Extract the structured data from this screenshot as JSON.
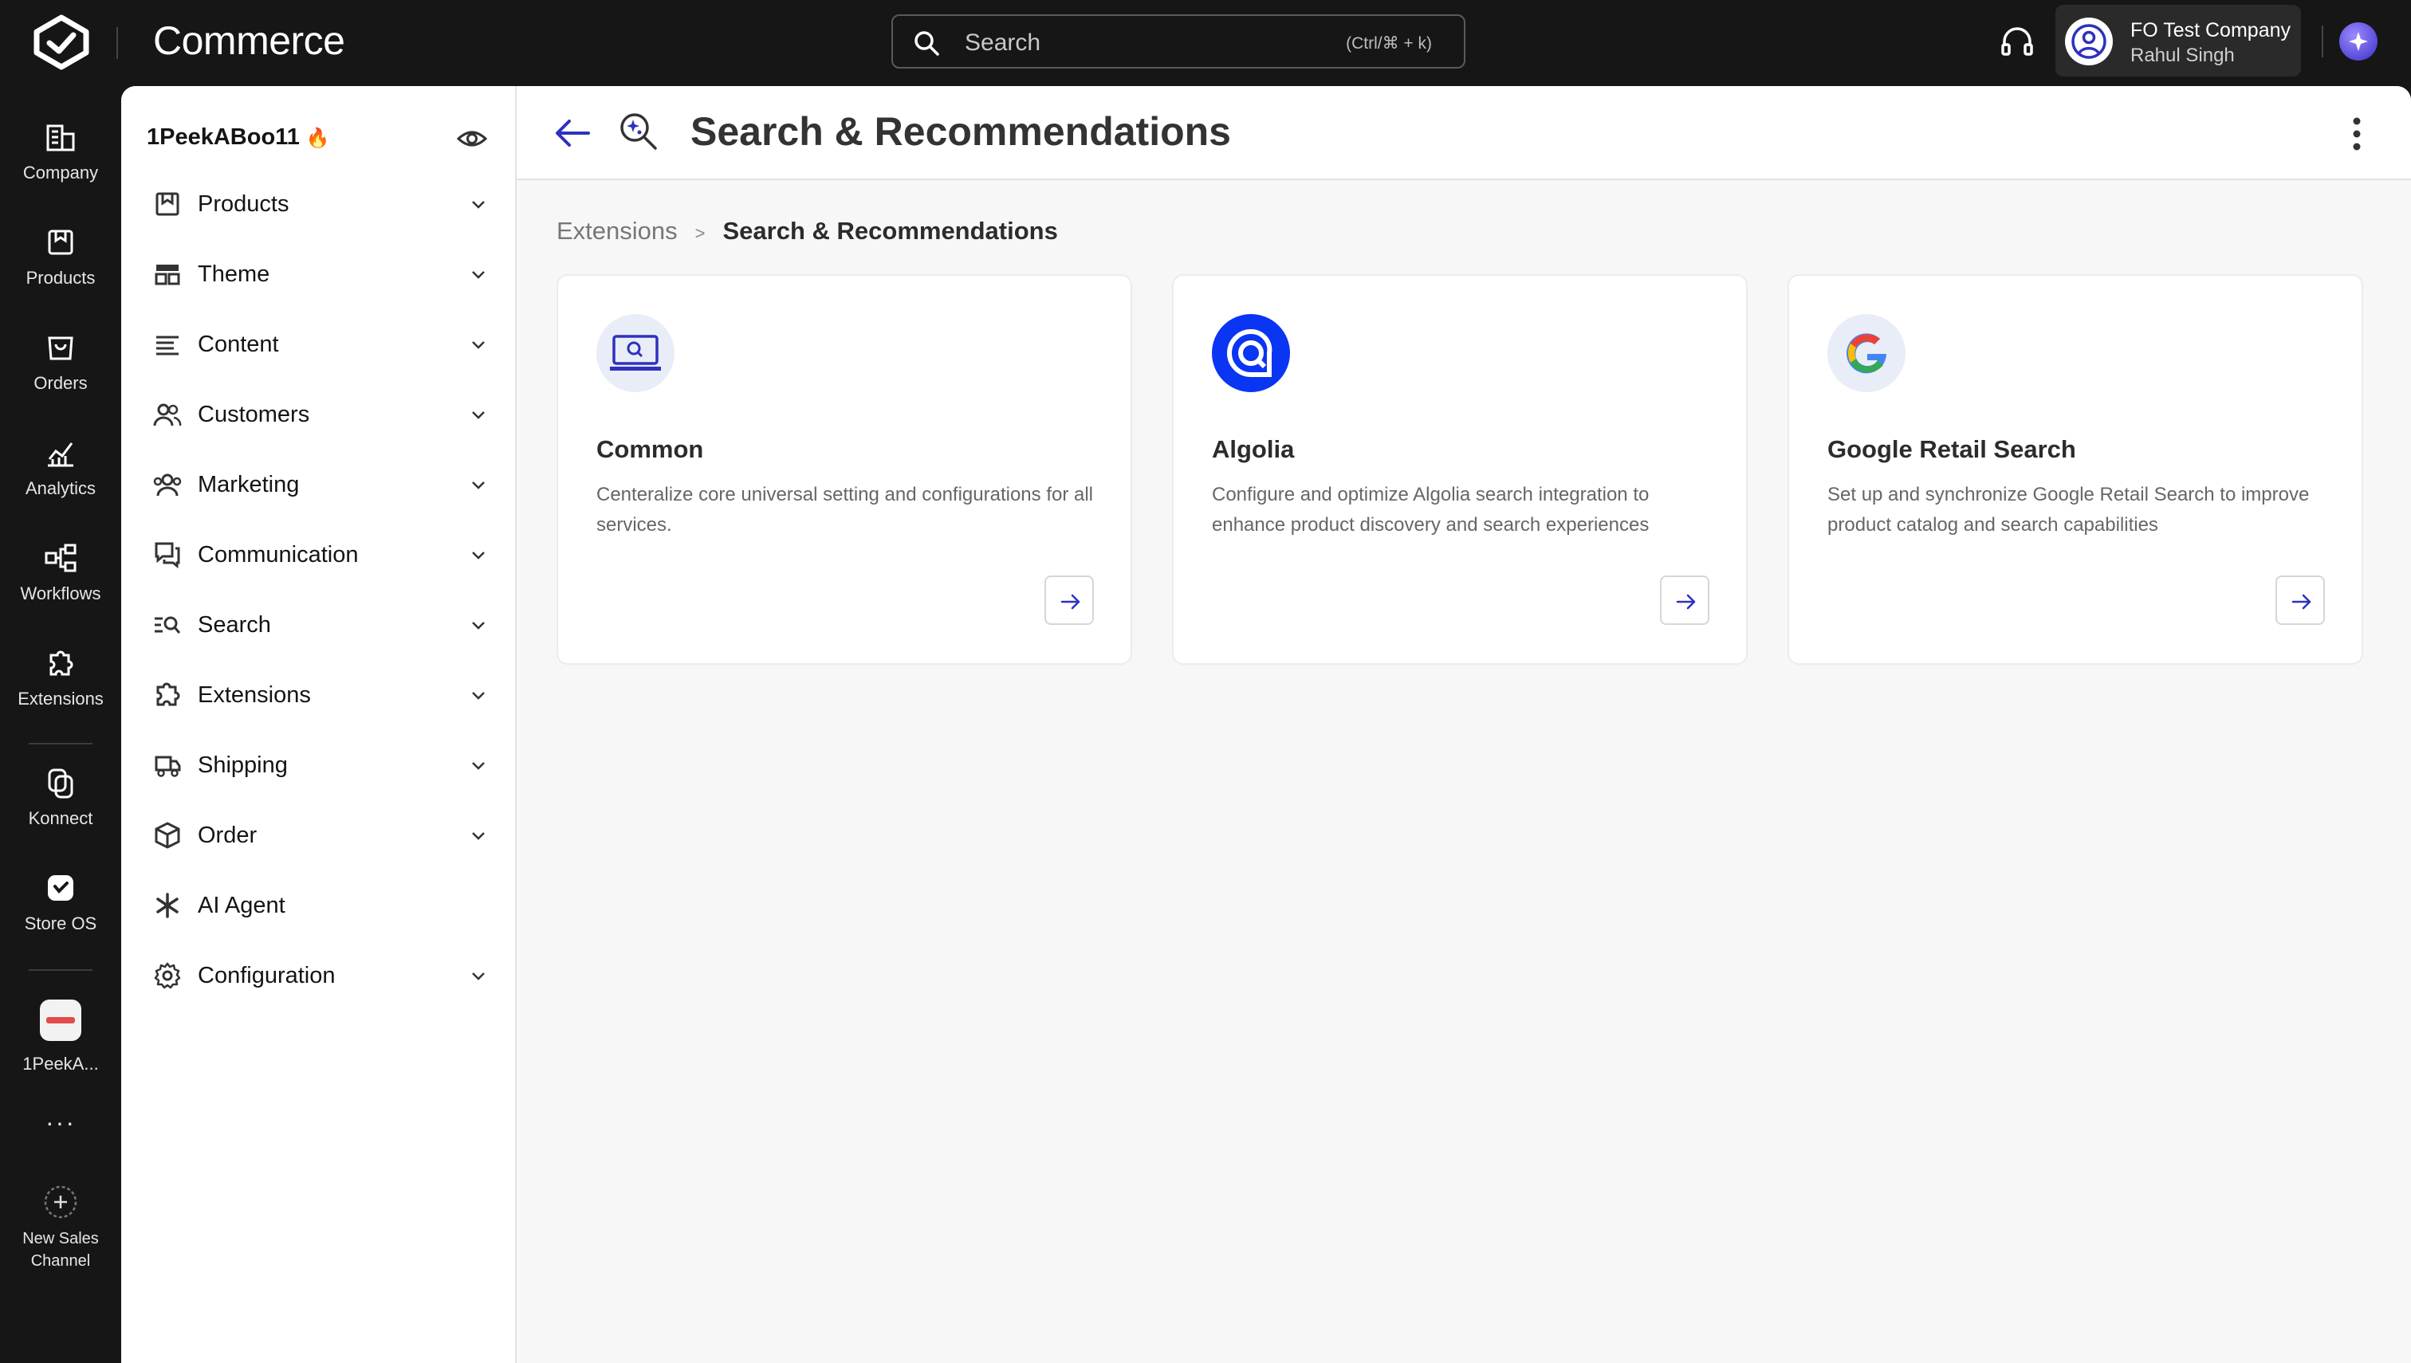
{
  "app": {
    "brand": "Commerce"
  },
  "search": {
    "placeholder": "Search",
    "shortcut": "(Ctrl/⌘ + k)"
  },
  "user": {
    "company": "FO Test Company",
    "name": "Rahul Singh"
  },
  "rail": {
    "items": [
      {
        "label": "Company",
        "icon": "company-icon"
      },
      {
        "label": "Products",
        "icon": "products-icon"
      },
      {
        "label": "Orders",
        "icon": "orders-icon"
      },
      {
        "label": "Analytics",
        "icon": "analytics-icon"
      },
      {
        "label": "Workflows",
        "icon": "workflows-icon"
      },
      {
        "label": "Extensions",
        "icon": "extensions-icon"
      },
      {
        "label": "Konnect",
        "icon": "konnect-icon"
      },
      {
        "label": "Store OS",
        "icon": "store-os-icon"
      },
      {
        "label": "1PeekA...",
        "icon": "store-logo"
      }
    ],
    "more": "···",
    "new_channel": "New Sales Channel"
  },
  "subnav": {
    "store_name": "1PeekABoo11",
    "store_badge": "🔥",
    "items": [
      {
        "label": "Products",
        "icon": "products-icon",
        "expandable": true
      },
      {
        "label": "Theme",
        "icon": "theme-icon",
        "expandable": true
      },
      {
        "label": "Content",
        "icon": "content-icon",
        "expandable": true
      },
      {
        "label": "Customers",
        "icon": "customers-icon",
        "expandable": true
      },
      {
        "label": "Marketing",
        "icon": "marketing-icon",
        "expandable": true
      },
      {
        "label": "Communication",
        "icon": "communication-icon",
        "expandable": true
      },
      {
        "label": "Search",
        "icon": "search-icon",
        "expandable": true
      },
      {
        "label": "Extensions",
        "icon": "extensions-icon",
        "expandable": true
      },
      {
        "label": "Shipping",
        "icon": "shipping-icon",
        "expandable": true
      },
      {
        "label": "Order",
        "icon": "order-icon",
        "expandable": true
      },
      {
        "label": "AI Agent",
        "icon": "ai-agent-icon",
        "expandable": false
      },
      {
        "label": "Configuration",
        "icon": "configuration-icon",
        "expandable": true
      }
    ]
  },
  "page": {
    "title": "Search & Recommendations",
    "breadcrumb": [
      "Extensions",
      ">",
      "Search & Recommendations"
    ]
  },
  "cards": [
    {
      "title": "Common",
      "description": "Centeralize core universal setting and configurations for all services.",
      "icon": "laptop-search-icon"
    },
    {
      "title": "Algolia",
      "description": "Configure and optimize Algolia search integration to enhance product discovery and search experiences",
      "icon": "algolia-logo-icon"
    },
    {
      "title": "Google Retail Search",
      "description": "Set up and synchronize Google Retail Search to improve product catalog and search capabilities",
      "icon": "google-logo-icon"
    }
  ],
  "colors": {
    "accent": "#2e31be",
    "algolia": "#0a35f2",
    "topbar": "#161616"
  }
}
